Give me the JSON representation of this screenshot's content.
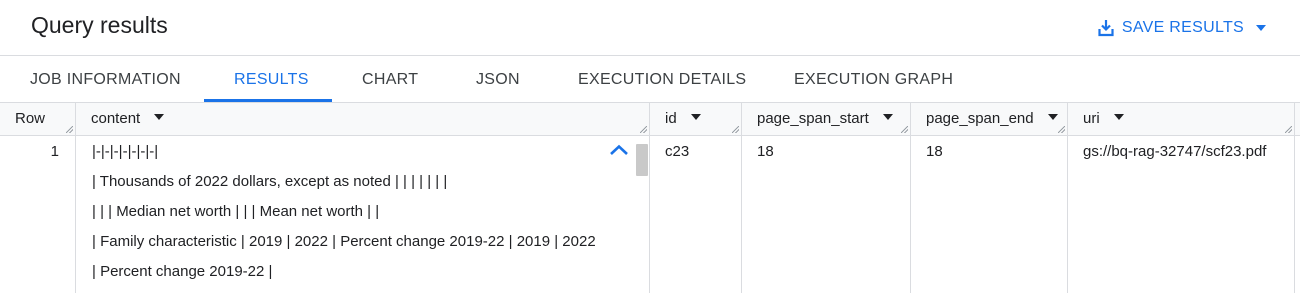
{
  "header": {
    "title": "Query results",
    "save_label": "SAVE RESULTS"
  },
  "tabs": [
    {
      "label": "JOB INFORMATION",
      "active": false
    },
    {
      "label": "RESULTS",
      "active": true
    },
    {
      "label": "CHART",
      "active": false
    },
    {
      "label": "JSON",
      "active": false
    },
    {
      "label": "EXECUTION DETAILS",
      "active": false
    },
    {
      "label": "EXECUTION GRAPH",
      "active": false
    }
  ],
  "table": {
    "columns": {
      "row": "Row",
      "content": "content",
      "id": "id",
      "page_span_start": "page_span_start",
      "page_span_end": "page_span_end",
      "uri": "uri"
    },
    "rows": [
      {
        "row": "1",
        "content_lines": [
          "|-|-|-|-|-|-|-|",
          "| Thousands of 2022 dollars, except as noted |  |  |  |  |  |  |",
          "|  |  | Median net worth |  |  | Mean net worth |  |",
          "| Family characteristic | 2019 | 2022 | Percent change 2019-22 | 2019 | 2022",
          "| Percent change 2019-22 |"
        ],
        "id": "c23",
        "page_span_start": "18",
        "page_span_end": "18",
        "uri": "gs://bq-rag-32747/scf23.pdf"
      }
    ]
  },
  "colors": {
    "accent": "#1a73e8",
    "text": "#202124",
    "border": "#dadce0",
    "header_bg": "#f8f9fa"
  }
}
